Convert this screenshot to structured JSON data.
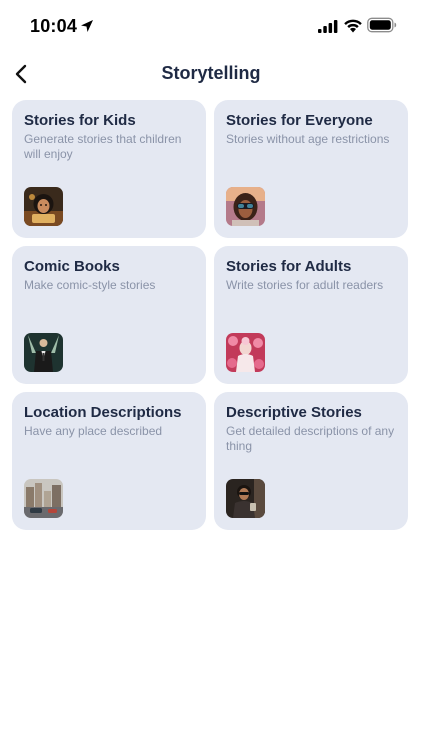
{
  "status": {
    "time": "10:04"
  },
  "nav": {
    "title": "Storytelling"
  },
  "cards": [
    {
      "title": "Stories for Kids",
      "subtitle": "Generate stories that children will enjoy",
      "icon": "kid-portrait-thumbnail"
    },
    {
      "title": "Stories for Everyone",
      "subtitle": "Stories without age restrictions",
      "icon": "vr-headset-portrait-thumbnail"
    },
    {
      "title": "Comic Books",
      "subtitle": "Make comic-style stories",
      "icon": "hero-figure-thumbnail"
    },
    {
      "title": "Stories for Adults",
      "subtitle": "Write stories for adult readers",
      "icon": "pink-flower-portrait-thumbnail"
    },
    {
      "title": "Location Descriptions",
      "subtitle": "Have any place described",
      "icon": "city-street-thumbnail"
    },
    {
      "title": "Descriptive Stories",
      "subtitle": "Get detailed descriptions of any thing",
      "icon": "person-portrait-thumbnail"
    }
  ]
}
